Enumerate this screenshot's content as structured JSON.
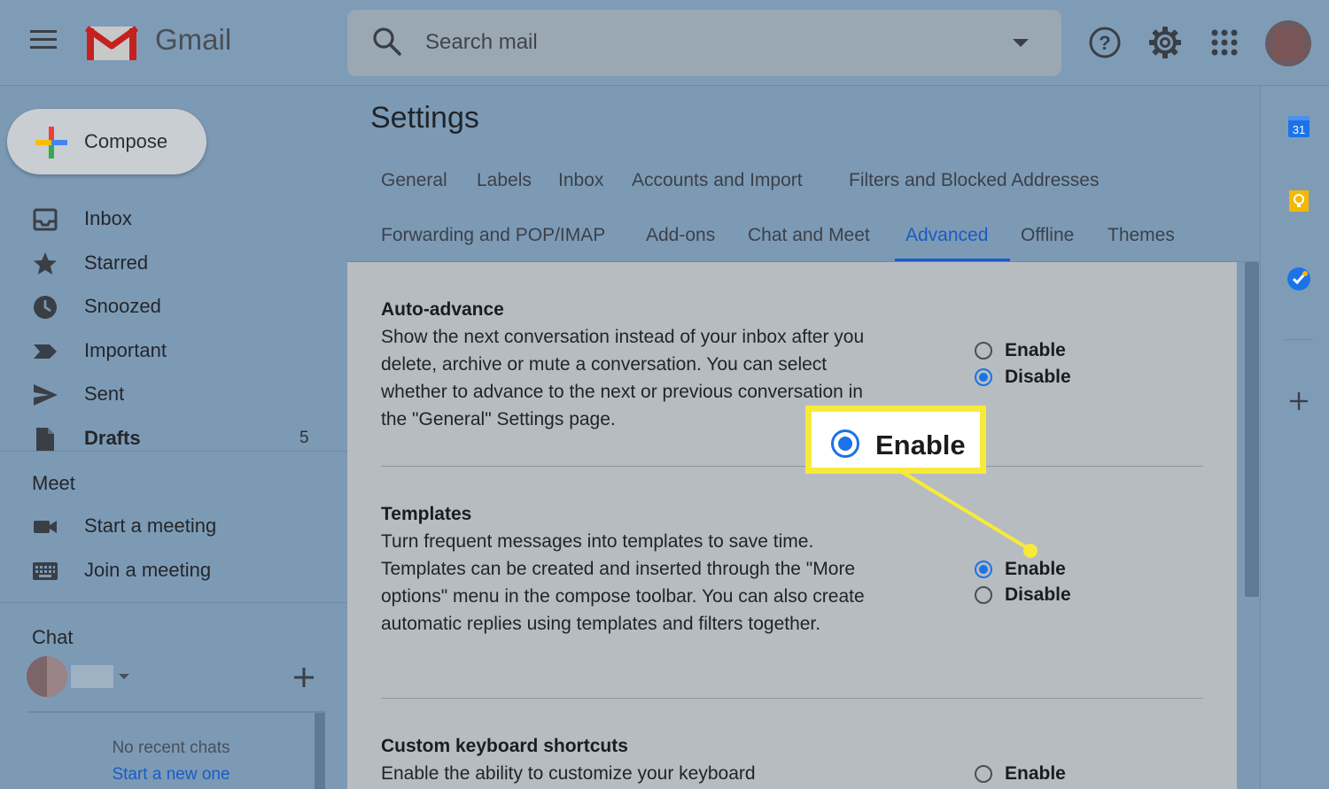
{
  "header": {
    "app_name": "Gmail",
    "search_placeholder": "Search mail",
    "icons": [
      "menu-icon",
      "search-icon",
      "dropdown-caret-icon",
      "help-icon",
      "gear-icon",
      "apps-grid-icon",
      "avatar"
    ]
  },
  "sidebar": {
    "compose_label": "Compose",
    "items": [
      {
        "label": "Inbox",
        "icon": "inbox-icon"
      },
      {
        "label": "Starred",
        "icon": "star-icon"
      },
      {
        "label": "Snoozed",
        "icon": "clock-icon"
      },
      {
        "label": "Important",
        "icon": "important-icon"
      },
      {
        "label": "Sent",
        "icon": "send-icon"
      },
      {
        "label": "Drafts",
        "icon": "draft-icon",
        "count": "5"
      }
    ],
    "meet_title": "Meet",
    "meet_items": [
      {
        "label": "Start a meeting",
        "icon": "video-camera-icon"
      },
      {
        "label": "Join a meeting",
        "icon": "keyboard-icon"
      }
    ],
    "chat_title": "Chat",
    "no_recent_chats": "No recent chats",
    "start_new": "Start a new one"
  },
  "main": {
    "title": "Settings",
    "tabs": [
      {
        "label": "General"
      },
      {
        "label": "Labels"
      },
      {
        "label": "Inbox"
      },
      {
        "label": "Accounts and Import"
      },
      {
        "label": "Filters and Blocked Addresses"
      },
      {
        "label": "Forwarding and POP/IMAP"
      },
      {
        "label": "Add-ons"
      },
      {
        "label": "Chat and Meet"
      },
      {
        "label": "Advanced",
        "active": true
      },
      {
        "label": "Offline"
      },
      {
        "label": "Themes"
      }
    ],
    "settings": [
      {
        "title": "Auto-advance",
        "description": "Show the next conversation instead of your inbox after you delete, archive or mute a conversation. You can select whether to advance to the next or previous conversation in the \"General\" Settings page.",
        "options": [
          "Enable",
          "Disable"
        ],
        "selected": "Disable"
      },
      {
        "title": "Templates",
        "description": "Turn frequent messages into templates to save time. Templates can be created and inserted through the \"More options\" menu in the compose toolbar. You can also create automatic replies using templates and filters together.",
        "options": [
          "Enable",
          "Disable"
        ],
        "selected": "Enable"
      },
      {
        "title": "Custom keyboard shortcuts",
        "description": "Enable the ability to customize your keyboard",
        "options": [
          "Enable"
        ],
        "selected": null
      }
    ]
  },
  "callout": {
    "label": "Enable",
    "color": "#f7ea3a"
  },
  "right_panel": {
    "apps": [
      "calendar-icon",
      "keep-icon",
      "tasks-icon"
    ],
    "calendar_day": "31"
  },
  "colors": {
    "accent": "#1a5bc4",
    "radio_selected": "#1a73e8",
    "highlight": "#f7ea3a"
  }
}
